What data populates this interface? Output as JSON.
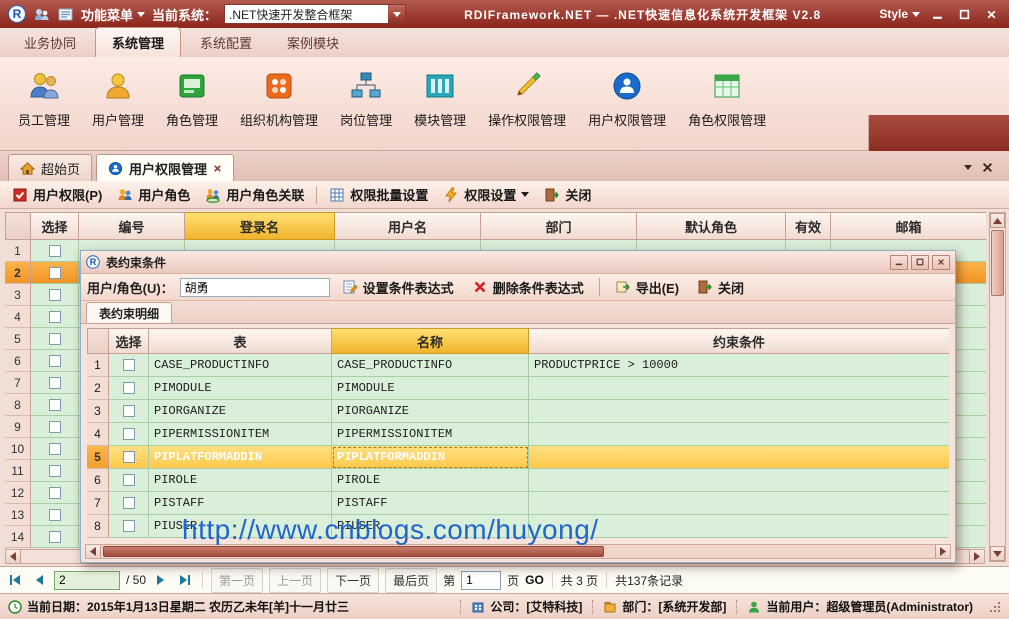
{
  "titlebar": {
    "menu_label": "功能菜单",
    "system_label": "当前系统：",
    "system_value": ".NET快速开发整合框架",
    "app_title": "RDIFramework.NET — .NET快速信息化系统开发框架 V2.8",
    "style_label": "Style"
  },
  "ribbon": {
    "active_tab": "系统管理",
    "tabs": [
      {
        "label": "业务协同"
      },
      {
        "label": "系统管理"
      },
      {
        "label": "系统配置"
      },
      {
        "label": "案例模块"
      }
    ],
    "items": [
      {
        "label": "员工管理",
        "icon": "staff-manage-icon"
      },
      {
        "label": "用户管理",
        "icon": "user-manage-icon"
      },
      {
        "label": "角色管理",
        "icon": "role-manage-icon"
      },
      {
        "label": "组织机构管理",
        "icon": "organization-manage-icon"
      },
      {
        "label": "岗位管理",
        "icon": "position-manage-icon"
      },
      {
        "label": "模块管理",
        "icon": "module-manage-icon"
      },
      {
        "label": "操作权限管理",
        "icon": "operation-permission-icon"
      },
      {
        "label": "用户权限管理",
        "icon": "user-permission-icon"
      },
      {
        "label": "角色权限管理",
        "icon": "role-permission-icon"
      }
    ]
  },
  "doc_tabs": {
    "start_tab": "超始页",
    "active_tab": "用户权限管理"
  },
  "toolbar": {
    "items": [
      {
        "label": "用户权限(P)"
      },
      {
        "label": "用户角色"
      },
      {
        "label": "用户角色关联"
      },
      {
        "label": "权限批量设置"
      },
      {
        "label": "权限设置"
      },
      {
        "label": "关闭"
      }
    ]
  },
  "main_grid": {
    "columns": [
      "选择",
      "编号",
      "登录名",
      "用户名",
      "部门",
      "默认角色",
      "有效",
      "邮箱"
    ],
    "rows": [
      {
        "num": "1",
        "state": ""
      },
      {
        "num": "2",
        "state": "selected"
      },
      {
        "num": "3",
        "state": ""
      },
      {
        "num": "4",
        "state": ""
      },
      {
        "num": "5",
        "state": ""
      },
      {
        "num": "6",
        "state": ""
      },
      {
        "num": "7",
        "state": ""
      },
      {
        "num": "8",
        "state": ""
      },
      {
        "num": "9",
        "state": ""
      },
      {
        "num": "10",
        "state": ""
      },
      {
        "num": "11",
        "state": ""
      },
      {
        "num": "12",
        "state": ""
      },
      {
        "num": "13",
        "state": ""
      },
      {
        "num": "14",
        "state": ""
      }
    ]
  },
  "dialog": {
    "title": "表约束条件",
    "toolbar": {
      "user_label": "用户/角色(U)：",
      "user_value": "胡勇",
      "set_expr_label": "设置条件表达式",
      "delete_expr_label": "删除条件表达式",
      "export_label": "导出(E)",
      "close_label": "关闭"
    },
    "tab": "表约束明细",
    "grid": {
      "columns": [
        "选择",
        "表",
        "名称",
        "约束条件"
      ],
      "rows": [
        {
          "num": "1",
          "table": "CASE_PRODUCTINFO",
          "name": "CASE_PRODUCTINFO",
          "constraint": "PRODUCTPRICE > 10000",
          "state": ""
        },
        {
          "num": "2",
          "table": "PIMODULE",
          "name": "PIMODULE",
          "constraint": "",
          "state": ""
        },
        {
          "num": "3",
          "table": "PIORGANIZE",
          "name": "PIORGANIZE",
          "constraint": "",
          "state": ""
        },
        {
          "num": "4",
          "table": "PIPERMISSIONITEM",
          "name": "PIPERMISSIONITEM",
          "constraint": "",
          "state": ""
        },
        {
          "num": "5",
          "table": "PIPLATFORMADDIN",
          "name": "PIPLATFORMADDIN",
          "constraint": "",
          "state": "selected"
        },
        {
          "num": "6",
          "table": "PIROLE",
          "name": "PIROLE",
          "constraint": "",
          "state": ""
        },
        {
          "num": "7",
          "table": "PISTAFF",
          "name": "PISTAFF",
          "constraint": "",
          "state": ""
        },
        {
          "num": "8",
          "table": "PIUSER",
          "name": "PIUSER",
          "constraint": "",
          "state": ""
        }
      ]
    }
  },
  "watermark": "http://www.cnblogs.com/huyong/",
  "pagination": {
    "page_value": "2",
    "page_total_label": "/ 50",
    "first_label": "第一页",
    "prev_label": "上一页",
    "next_label": "下一页",
    "last_label": "最后页",
    "goto_prefix": "第",
    "goto_value": "1",
    "goto_suffix": "页",
    "go_label": "GO",
    "pages_info": "共 3 页",
    "records_info": "共137条记录"
  },
  "statusbar": {
    "date": "当前日期：2015年1月13日星期二 农历乙未年[羊]十一月廿三",
    "company": "公司：[艾特科技]",
    "department": "部门：[系统开发部]",
    "user": "当前用户：超级管理员(Administrator)"
  }
}
